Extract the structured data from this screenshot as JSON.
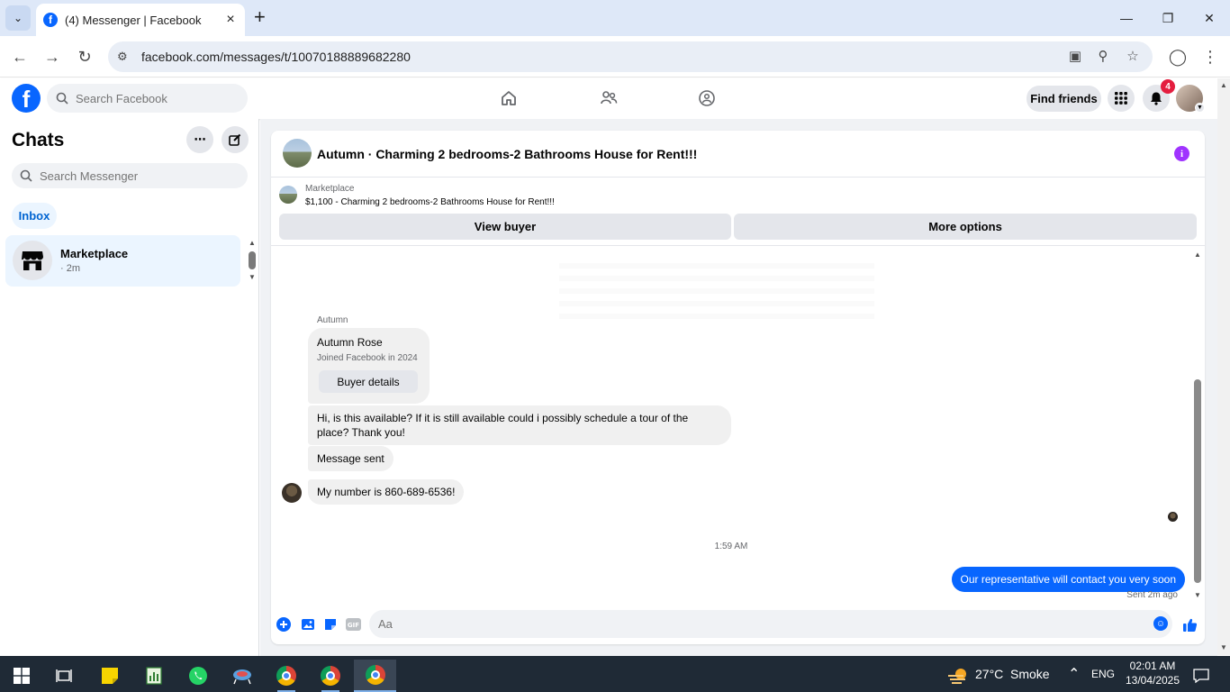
{
  "browser": {
    "tab_title": "(4) Messenger | Facebook",
    "url": "facebook.com/messages/t/10070188889682280"
  },
  "header": {
    "search_placeholder": "Search Facebook",
    "find_friends": "Find friends",
    "notification_count": "4",
    "brand_color": "#0866ff"
  },
  "sidebar": {
    "title": "Chats",
    "search_placeholder": "Search Messenger",
    "inbox_label": "Inbox",
    "chats": [
      {
        "name": "Marketplace",
        "time": "· 2m"
      }
    ]
  },
  "conversation": {
    "title": "Autumn · Charming 2 bedrooms-2 Bathrooms House for Rent!!!",
    "listing": {
      "label": "Marketplace",
      "price_title": "$1,100 - Charming 2 bedrooms-2 Bathrooms House for Rent!!!",
      "view_buyer": "View buyer",
      "more_options": "More options"
    },
    "sender_label": "Autumn",
    "profile_card": {
      "name": "Autumn Rose",
      "joined": "Joined Facebook in 2024",
      "button": "Buyer details"
    },
    "incoming": [
      "Hi, is this available? If it is still available could i possibly schedule a tour of the place? Thank you!",
      "Message sent",
      "My number is 860-689-6536!"
    ],
    "timestamp": "1:59 AM",
    "outgoing": "Our representative will contact you very soon",
    "sent_status": "Sent 2m ago",
    "composer_placeholder": "Aa"
  },
  "taskbar": {
    "weather_temp": "27°C",
    "weather_desc": "Smoke",
    "language": "ENG",
    "time": "02:01 AM",
    "date": "13/04/2025"
  }
}
